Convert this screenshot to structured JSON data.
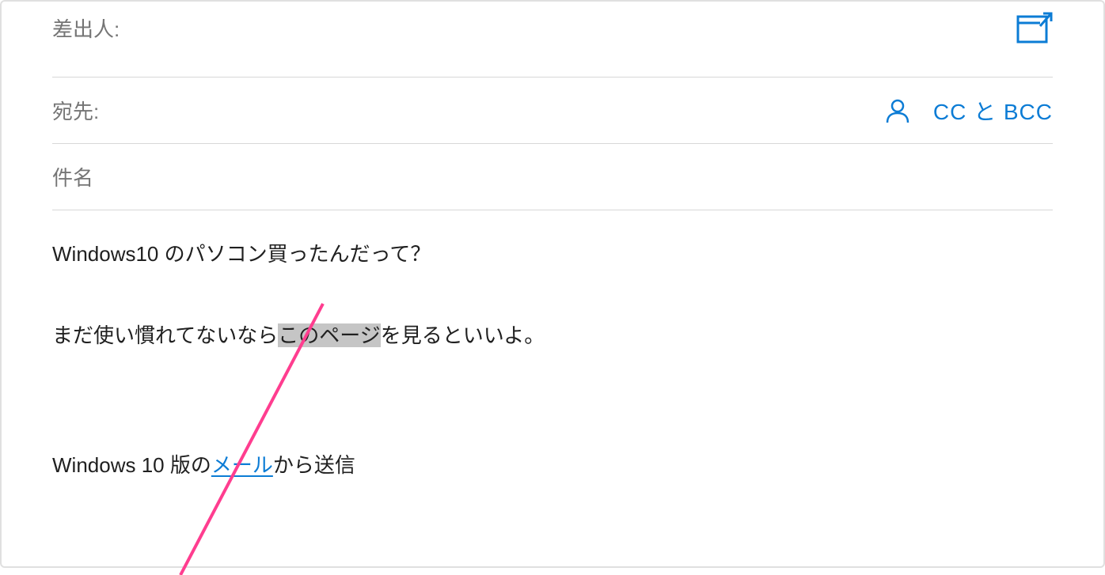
{
  "header": {
    "from_label": "差出人:",
    "to_label": "宛先:",
    "cc_bcc_label": "CC と BCC",
    "subject_label": "件名"
  },
  "body": {
    "line1": "Windows10 のパソコン買ったんだって？",
    "line2_before": "まだ使い慣れてないなら",
    "line2_highlight": "このページ",
    "line2_after": "を見るといいよ。"
  },
  "signature": {
    "prefix": "Windows 10 版の",
    "link_text": "メール",
    "suffix": "から送信"
  },
  "icons": {
    "popout": "popout-icon",
    "contact": "contact-icon"
  }
}
